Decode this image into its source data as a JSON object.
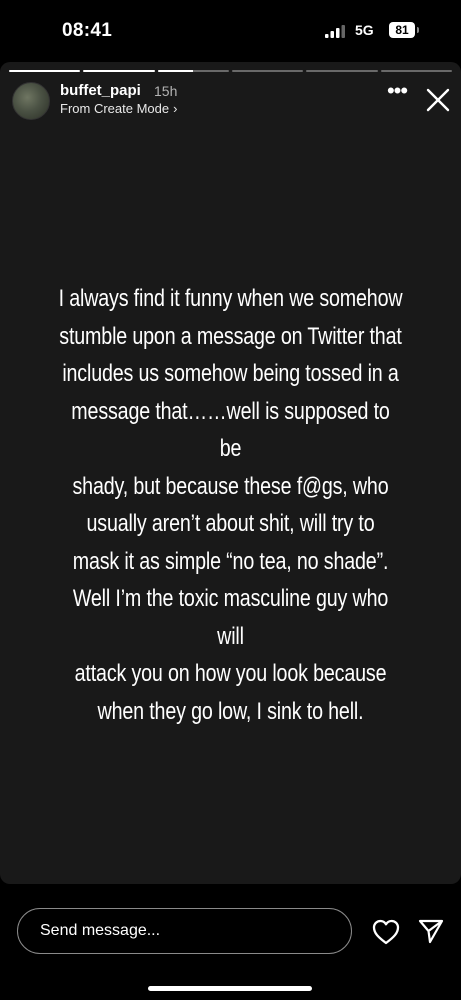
{
  "status_bar": {
    "time": "08:41",
    "network": "5G",
    "battery": "81"
  },
  "story": {
    "progress": [
      1,
      1,
      0.5,
      0,
      0,
      0
    ],
    "username": "buffet_papi",
    "time_ago": "15h",
    "subtitle": "From Create Mode",
    "subtitle_icon": "chevron-right-icon",
    "text_lines": [
      "I always find it funny when we somehow",
      "stumble upon a message on Twitter that",
      "includes us somehow being tossed in a",
      "message that……well is supposed to be",
      "shady, but because these f@gs, who",
      "usually aren’t about shit, will try to",
      "mask it as simple “no tea, no shade”.",
      "Well I’m the toxic masculine guy who will",
      "attack you on how you look because",
      "when they go low, I sink to hell."
    ]
  },
  "reply": {
    "placeholder": "Send message..."
  },
  "colors": {
    "background": "#000000",
    "story_card": "#191919",
    "text": "#ffffff"
  }
}
